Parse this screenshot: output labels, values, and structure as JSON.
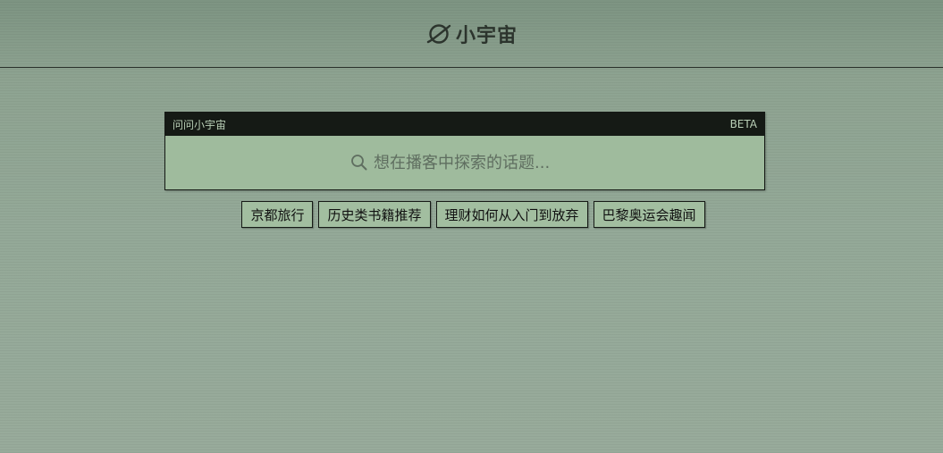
{
  "header": {
    "brand_name": "小宇宙",
    "logo_icon": "planet-icon"
  },
  "ask": {
    "title": "问问小宇宙",
    "badge": "BETA",
    "placeholder": "想在播客中探索的话题...",
    "search_icon": "search-icon"
  },
  "suggestions": [
    {
      "label": "京都旅行"
    },
    {
      "label": "历史类书籍推荐"
    },
    {
      "label": "理财如何从入门到放弃"
    },
    {
      "label": "巴黎奥运会趣闻"
    }
  ],
  "colors": {
    "background": "#8fa593",
    "panel": "#9fbb9d",
    "panel_header": "#151a15",
    "text_dark": "#2c342d"
  }
}
